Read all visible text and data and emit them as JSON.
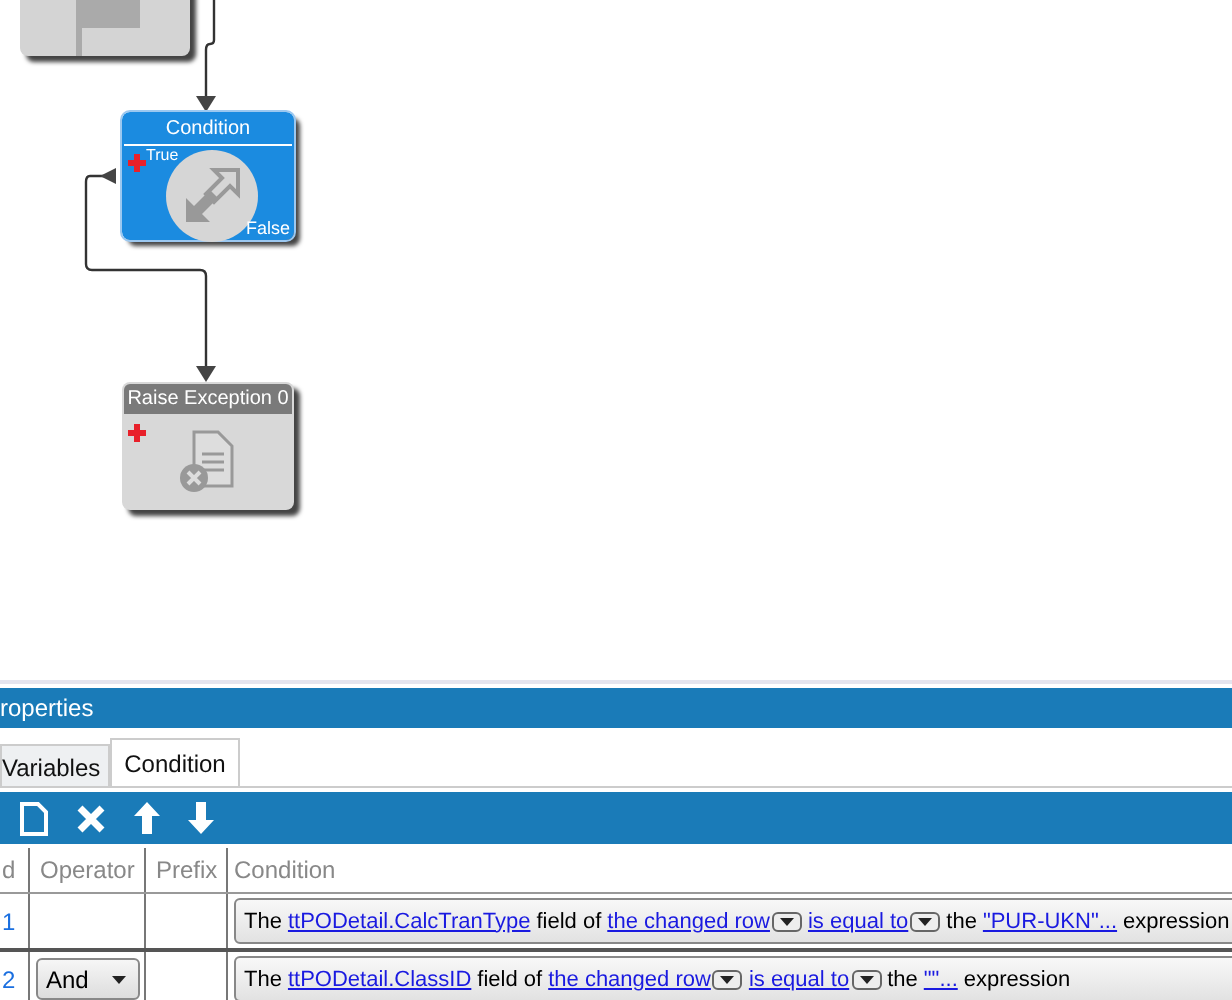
{
  "canvas": {
    "nodes": [
      {
        "kind": "flag",
        "selected": false
      },
      {
        "kind": "condition",
        "title": "Condition",
        "true_label": "True",
        "false_label": "False",
        "selected": true
      },
      {
        "kind": "exception",
        "title": "Raise Exception 0",
        "selected": false
      }
    ]
  },
  "panel": {
    "title": "roperties",
    "tabs": [
      {
        "label": "Variables",
        "selected": false
      },
      {
        "label": "Condition",
        "selected": true
      }
    ],
    "table": {
      "columns": [
        "d",
        "Operator",
        "Prefix",
        "Condition"
      ],
      "rows": [
        {
          "id": "1",
          "condition": [
            {
              "kind": "text",
              "text": "The"
            },
            {
              "kind": "link",
              "text": "ttPODetail.CalcTranType"
            },
            {
              "kind": "text",
              "text": "field of"
            },
            {
              "kind": "link",
              "text": "the changed row"
            },
            {
              "kind": "dropdown"
            },
            {
              "kind": "link",
              "text": "is equal to"
            },
            {
              "kind": "dropdown"
            },
            {
              "kind": "text",
              "text": "the"
            },
            {
              "kind": "link",
              "text": "\"PUR-UKN\"..."
            },
            {
              "kind": "text",
              "text": "expression"
            }
          ]
        },
        {
          "id": "2",
          "operator": "And",
          "condition": [
            {
              "kind": "text",
              "text": "The"
            },
            {
              "kind": "link",
              "text": "ttPODetail.ClassID"
            },
            {
              "kind": "text",
              "text": "field of"
            },
            {
              "kind": "link",
              "text": "the changed row"
            },
            {
              "kind": "dropdown"
            },
            {
              "kind": "link",
              "text": "is equal to"
            },
            {
              "kind": "dropdown"
            },
            {
              "kind": "text",
              "text": "the"
            },
            {
              "kind": "link",
              "text": "\"\"..."
            },
            {
              "kind": "text",
              "text": "expression"
            }
          ]
        }
      ]
    }
  }
}
